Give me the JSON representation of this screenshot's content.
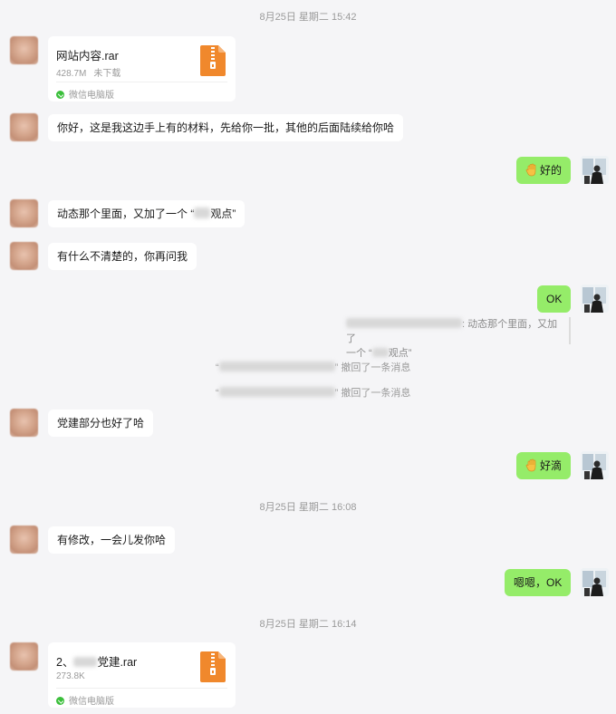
{
  "timestamps": [
    "8月25日 星期二 15:42",
    "8月25日 星期二 16:08",
    "8月25日 星期二 16:14"
  ],
  "file1": {
    "name": "网站内容.rar",
    "size": "428.7M",
    "status": "未下载",
    "source": "微信电脑版",
    "icon": "zip-file-icon"
  },
  "file2": {
    "prefix": "2、",
    "suffix": "党建.rar",
    "size": "273.8K",
    "source": "微信电脑版",
    "icon": "zip-file-icon"
  },
  "messages": {
    "m1": "你好，这是我这边手上有的材料，先给你一批，其他的后面陆续给你哈",
    "m2": "好的",
    "m3_prefix": "动态那个里面，又加了一个 “",
    "m3_suffix": "观点”",
    "m4": "有什么不清楚的，你再问我",
    "m5": "OK",
    "m6": "党建部分也好了哈",
    "m7": "好滴",
    "m8": "有修改，一会儿发你哈",
    "m9": "嗯嗯，OK"
  },
  "quote": {
    "text_line1": ": 动态那个里面，又加了",
    "text_line2_prefix": "一个 “",
    "text_line2_suffix": "观点”"
  },
  "recalls": [
    {
      "open": "“",
      "close": "” 撤回了一条消息"
    },
    {
      "open": "“",
      "close": "” 撤回了一条消息"
    }
  ],
  "colors": {
    "background": "#f5f5f7",
    "self_bubble": "#95ec69",
    "other_bubble": "#ffffff",
    "zip_icon": "#f0882c",
    "wechat_green": "#3bbf3b"
  }
}
